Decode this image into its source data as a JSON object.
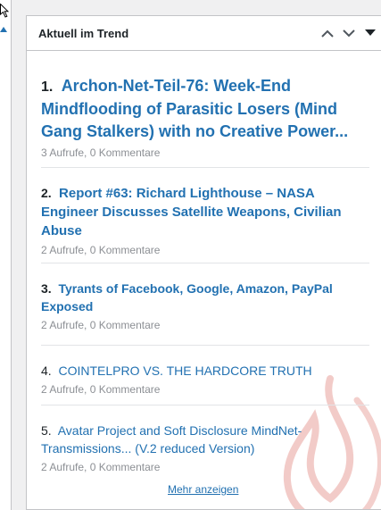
{
  "widget": {
    "title": "Aktuell im Trend",
    "controls": [
      "chevron-up-icon",
      "chevron-down-icon",
      "toggle-triangle-icon"
    ],
    "more_label": "Mehr anzeigen",
    "accent_color": "#2271b1",
    "flame_color": "#e8a09a"
  },
  "items": [
    {
      "number": "1.",
      "title": "Archon-Net-Teil-76: Week-End Mindflooding of Parasitic Losers (Mind Gang Stalkers) with no Creative Power...",
      "views": "3 Aufrufe",
      "separator": ", ",
      "comments": "0 Kommentare"
    },
    {
      "number": "2.",
      "title": "Report #63: Richard Lighthouse – NASA Engineer Discusses Satellite Weapons, Civilian Abuse",
      "views": "2 Aufrufe",
      "separator": ", ",
      "comments": "0 Kommentare"
    },
    {
      "number": "3.",
      "title": "Tyrants of Facebook, Google, Amazon, PayPal Exposed",
      "views": "2 Aufrufe",
      "separator": ", ",
      "comments": "0 Kommentare"
    },
    {
      "number": "4.",
      "title": "COINTELPRO VS. THE HARDCORE TRUTH",
      "views": "2 Aufrufe",
      "separator": ", ",
      "comments": "0 Kommentare"
    },
    {
      "number": "5.",
      "title": "Avatar Project and Soft Disclosure MindNet-Transmissions... (V.2 reduced Version)",
      "views": "2 Aufrufe",
      "separator": ", ",
      "comments": "0 Kommentare"
    }
  ]
}
